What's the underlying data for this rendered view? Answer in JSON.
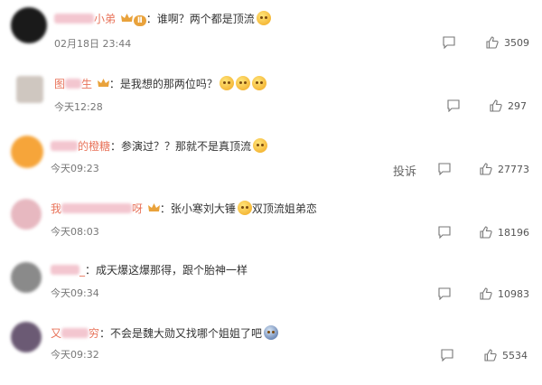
{
  "comments": [
    {
      "name_visible": "小弟",
      "level_badge": "Ⅱ",
      "text": "谁啊？两个都是顶流",
      "emoji_count": 1,
      "time": "02月18日 23:44",
      "likes": "3509",
      "avatar_color": "#1a1a1a"
    },
    {
      "name_visible_prefix": "图",
      "name_visible": "生",
      "text": "是我想的那两位吗？",
      "emoji_count": 3,
      "time": "今天12:28",
      "likes": "297",
      "avatar_color": "#cfc7c0"
    },
    {
      "name_visible": "的橙糖",
      "text": "参演过？？那就不是真顶流",
      "emoji_count": 1,
      "time": "今天09:23",
      "likes": "27773",
      "report_label": "投诉",
      "avatar_color": "#f6a53a"
    },
    {
      "name_visible_prefix": "我",
      "name_visible": "呀",
      "text_part1": "张小寒刘大锤",
      "text_part2": "双顶流姐弟恋",
      "time": "今天08:03",
      "likes": "18196",
      "avatar_color": "#e7b8c0"
    },
    {
      "name_visible": "_",
      "text": "成天爆这爆那得，跟个胎神一样",
      "time": "今天09:34",
      "likes": "10983",
      "avatar_color": "#8a8a8a"
    },
    {
      "name_visible_prefix": "又",
      "name_visible": "穷",
      "text": "不会是魏大勋又找哪个姐姐了吧",
      "emoji_count": 1,
      "time": "今天09:32",
      "likes": "5534",
      "avatar_color": "#6b5a74"
    }
  ]
}
